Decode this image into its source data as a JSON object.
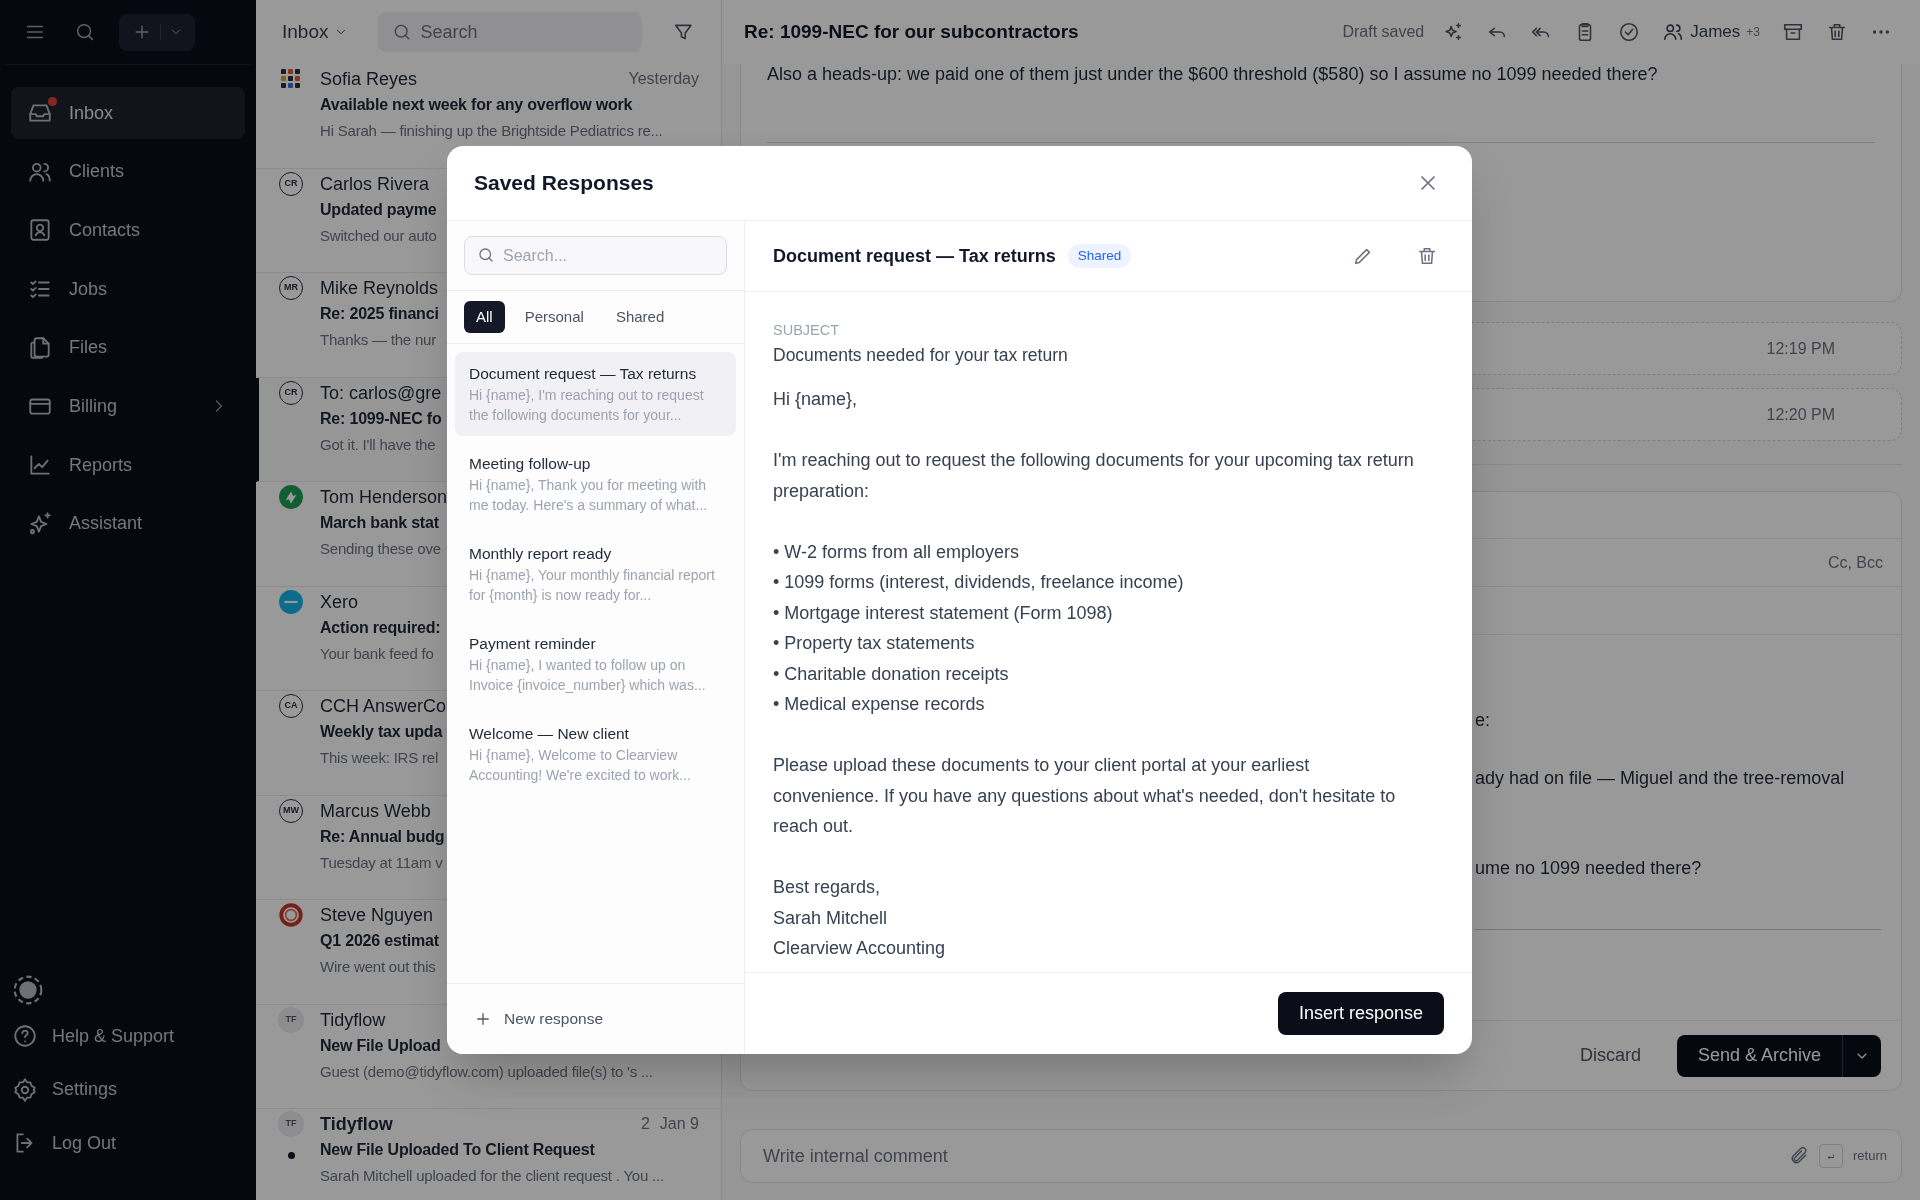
{
  "sidebar": {
    "items": [
      {
        "label": "Inbox",
        "selected": true,
        "has_dot": true,
        "expandable": false
      },
      {
        "label": "Clients",
        "selected": false,
        "has_dot": false,
        "expandable": false
      },
      {
        "label": "Contacts",
        "selected": false,
        "has_dot": false,
        "expandable": false
      },
      {
        "label": "Jobs",
        "selected": false,
        "has_dot": false,
        "expandable": false
      },
      {
        "label": "Files",
        "selected": false,
        "has_dot": false,
        "expandable": false
      },
      {
        "label": "Billing",
        "selected": false,
        "has_dot": false,
        "expandable": true
      },
      {
        "label": "Reports",
        "selected": false,
        "has_dot": false,
        "expandable": false
      },
      {
        "label": "Assistant",
        "selected": false,
        "has_dot": false,
        "expandable": false
      }
    ],
    "footer": [
      "Help & Support",
      "Settings",
      "Log Out"
    ]
  },
  "list": {
    "folder": "Inbox",
    "search_placeholder": "Search",
    "emails": [
      {
        "sender": "Sofia Reyes",
        "date": "Yesterday",
        "subject": "Available next week for any overflow work",
        "preview": "Hi Sarah — finishing up the Brightside Pediatrics re...",
        "avatar": {
          "kind": "grid"
        },
        "unread": false,
        "selected": false
      },
      {
        "sender": "Carlos Rivera",
        "subject": "Updated payme",
        "preview": "Switched our auto",
        "avatar": {
          "kind": "initials",
          "initials": "CR"
        },
        "unread": false,
        "selected": false
      },
      {
        "sender": "Mike Reynolds",
        "subject": "Re: 2025 financi",
        "preview": "Thanks — the nur",
        "avatar": {
          "kind": "initials",
          "initials": "MR"
        },
        "unread": false,
        "selected": false
      },
      {
        "sender": "To: carlos@gre",
        "subject": "Re: 1099-NEC fo",
        "preview": "Got it. I'll have the",
        "avatar": {
          "kind": "initials",
          "initials": "CR"
        },
        "unread": false,
        "selected": true
      },
      {
        "sender": "Tom Henderson",
        "subject": "March bank stat",
        "preview": "Sending these ove",
        "avatar": {
          "kind": "green"
        },
        "unread": false,
        "selected": false
      },
      {
        "sender": "Xero",
        "subject": "Action required:",
        "preview": "Your bank feed fo",
        "avatar": {
          "kind": "blue"
        },
        "unread": false,
        "selected": false
      },
      {
        "sender": "CCH AnswerCo",
        "subject": "Weekly tax upda",
        "preview": "This week: IRS rel",
        "avatar": {
          "kind": "initials",
          "initials": "CA"
        },
        "unread": false,
        "selected": false
      },
      {
        "sender": "Marcus Webb",
        "subject": "Re: Annual budg",
        "preview": "Tuesday at 11am v",
        "avatar": {
          "kind": "initials",
          "initials": "MW"
        },
        "unread": false,
        "selected": false
      },
      {
        "sender": "Steve Nguyen",
        "subject": "Q1 2026 estimat",
        "preview": "Wire went out this",
        "avatar": {
          "kind": "red"
        },
        "unread": false,
        "selected": false
      },
      {
        "sender": "Tidyflow",
        "subject": "New File Upload",
        "preview": "Guest (demo@tidyflow.com) uploaded file(s) to 's ...",
        "avatar": {
          "kind": "soft",
          "initials": "TF"
        },
        "unread": false,
        "selected": false
      },
      {
        "sender": "Tidyflow",
        "count": "2",
        "date": "Jan 9",
        "subject": "New File Uploaded To Client Request",
        "preview": "Sarah Mitchell uploaded for the client request . You ...",
        "avatar": {
          "kind": "soft",
          "initials": "TF"
        },
        "unread": true,
        "selected": false
      }
    ]
  },
  "thread": {
    "title": "Re: 1099-NEC for our subcontractors",
    "draft_status": "Draft saved",
    "participant": "James",
    "participant_more": "+3",
    "message": "Also a heads-up: we paid one of them just under the $600 threshold ($580) so I assume no 1099 needed there?",
    "collapsed_times": [
      "12:19 PM",
      "12:20 PM"
    ],
    "composer": {
      "cc_label": "Cc, Bcc",
      "fragments": [
        "e:",
        "ady had on file — Miguel and the tree-removal",
        "ume no 1099 needed there?"
      ],
      "discard": "Discard",
      "send": "Send & Archive"
    },
    "comment": {
      "placeholder": "Write internal comment",
      "key": "↵",
      "key_label": "return"
    }
  },
  "modal": {
    "title": "Saved Responses",
    "search_placeholder": "Search...",
    "filters": [
      {
        "label": "All",
        "selected": true
      },
      {
        "label": "Personal",
        "selected": false
      },
      {
        "label": "Shared",
        "selected": false
      }
    ],
    "responses": [
      {
        "title": "Document request — Tax returns",
        "preview": "Hi {name}, I'm reaching out to request the following documents for your...",
        "selected": true
      },
      {
        "title": "Meeting follow-up",
        "preview": "Hi {name}, Thank you for meeting with me today. Here's a summary of what...",
        "selected": false
      },
      {
        "title": "Monthly report ready",
        "preview": "Hi {name}, Your monthly financial report for {month} is now ready for...",
        "selected": false
      },
      {
        "title": "Payment reminder",
        "preview": "Hi {name}, I wanted to follow up on Invoice {invoice_number} which was...",
        "selected": false
      },
      {
        "title": "Welcome — New client",
        "preview": "Hi {name}, Welcome to Clearview Accounting! We're excited to work...",
        "selected": false
      }
    ],
    "new_response": "New response",
    "detail": {
      "title": "Document request — Tax returns",
      "badge": "Shared",
      "subject_label": "SUBJECT",
      "subject": "Documents needed for your tax return",
      "blocks": [
        {
          "kind": "lines",
          "lines": [
            "Hi {name},"
          ]
        },
        {
          "kind": "lines",
          "lines": [
            "I'm reaching out to request the following documents for your upcoming tax return preparation:"
          ]
        },
        {
          "kind": "lines",
          "lines": [
            "• W-2 forms from all employers",
            "• 1099 forms (interest, dividends, freelance income)",
            "• Mortgage interest statement (Form 1098)",
            "• Property tax statements",
            "• Charitable donation receipts",
            "• Medical expense records"
          ]
        },
        {
          "kind": "lines",
          "lines": [
            "Please upload these documents to your client portal at your earliest convenience. If you have any questions about what's needed, don't hesitate to reach out."
          ]
        },
        {
          "kind": "lines",
          "lines": [
            "Best regards,",
            "Sarah Mitchell",
            "Clearview Accounting"
          ]
        }
      ],
      "insert": "Insert response"
    }
  }
}
